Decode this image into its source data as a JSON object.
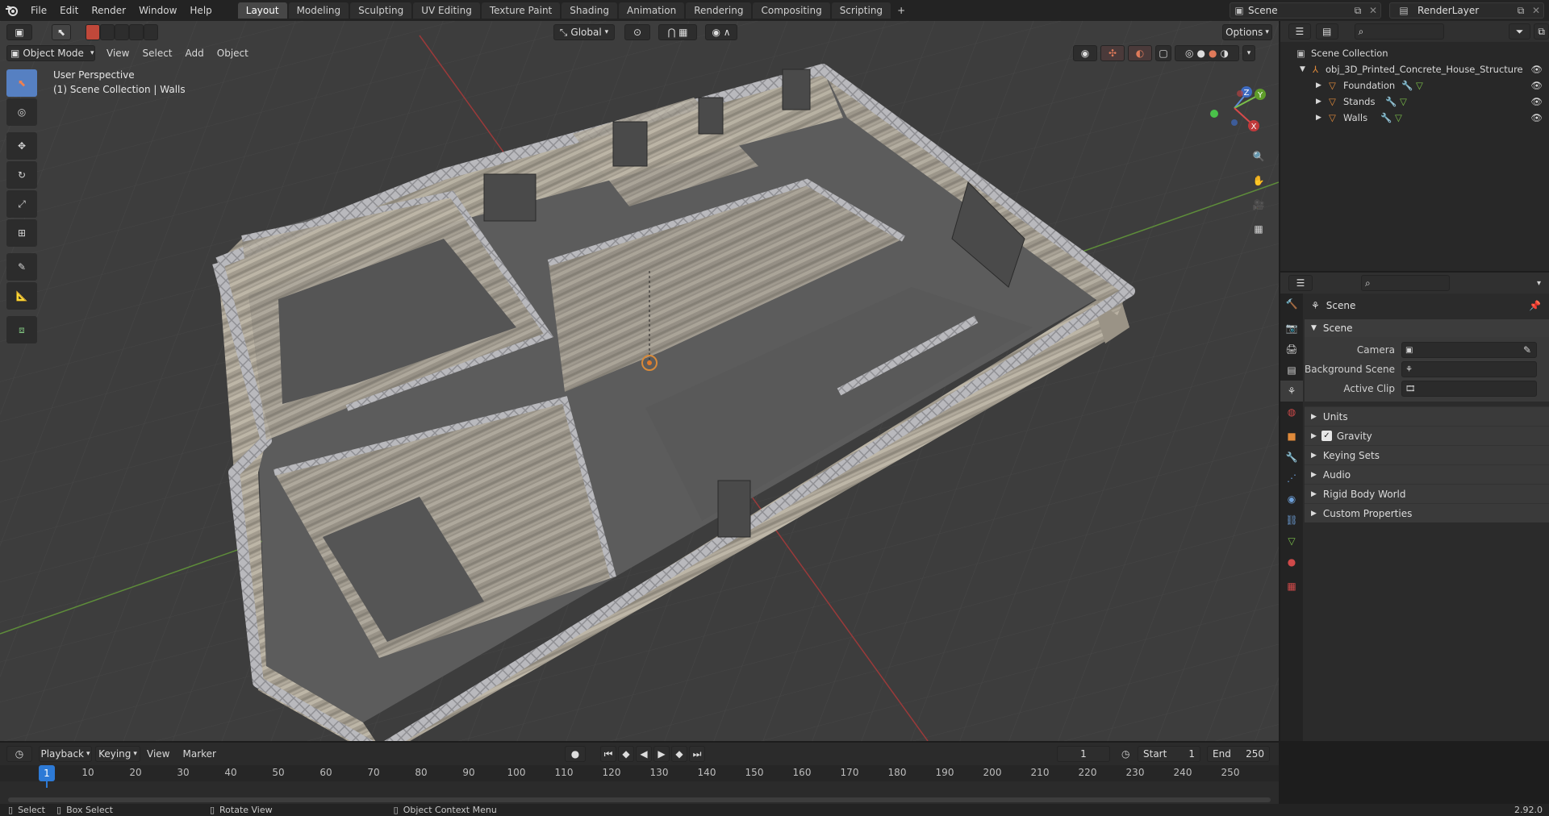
{
  "topbar": {
    "menus": [
      "File",
      "Edit",
      "Render",
      "Window",
      "Help"
    ],
    "workspaces": [
      "Layout",
      "Modeling",
      "Sculpting",
      "UV Editing",
      "Texture Paint",
      "Shading",
      "Animation",
      "Rendering",
      "Compositing",
      "Scripting"
    ],
    "active_workspace": "Layout",
    "add_tab": "+",
    "scene_name": "Scene",
    "view_layer": "RenderLayer"
  },
  "viewport": {
    "mode": "Object Mode",
    "menus": [
      "View",
      "Select",
      "Add",
      "Object"
    ],
    "transform_orientation": "Global",
    "options_label": "Options",
    "perspective_label": "User Perspective",
    "collection_label": "(1) Scene Collection | Walls",
    "gizmo_axes": {
      "x": "X",
      "y": "Y",
      "z": "Z"
    },
    "colors": {
      "bg": "#3d3d3d",
      "grid": "#474747",
      "x_axis": "#9b3a3a",
      "y_axis": "#5e8d3a",
      "accent": "#5680c2"
    }
  },
  "outliner": {
    "root": "Scene Collection",
    "object": "obj_3D_Printed_Concrete_House_Structure",
    "children": [
      "Foundation",
      "Stands",
      "Walls"
    ]
  },
  "properties": {
    "title": "Scene",
    "panel": "Scene",
    "fields": [
      {
        "label": "Camera",
        "value": ""
      },
      {
        "label": "Background Scene",
        "value": ""
      },
      {
        "label": "Active Clip",
        "value": ""
      }
    ],
    "subpanels": [
      "Units",
      "Gravity",
      "Keying Sets",
      "Audio",
      "Rigid Body World",
      "Custom Properties"
    ],
    "gravity_checked": true
  },
  "timeline": {
    "menus": [
      "Playback",
      "Keying",
      "View",
      "Marker"
    ],
    "current_frame": "1",
    "start_label": "Start",
    "start": "1",
    "end_label": "End",
    "end": "250",
    "ticks": [
      "1",
      "10",
      "20",
      "30",
      "40",
      "50",
      "60",
      "70",
      "80",
      "90",
      "100",
      "110",
      "120",
      "130",
      "140",
      "150",
      "160",
      "170",
      "180",
      "190",
      "200",
      "210",
      "220",
      "230",
      "240",
      "250"
    ]
  },
  "statusbar": {
    "items": [
      "Select",
      "Box Select",
      "Rotate View",
      "Object Context Menu"
    ],
    "version": "2.92.0"
  }
}
